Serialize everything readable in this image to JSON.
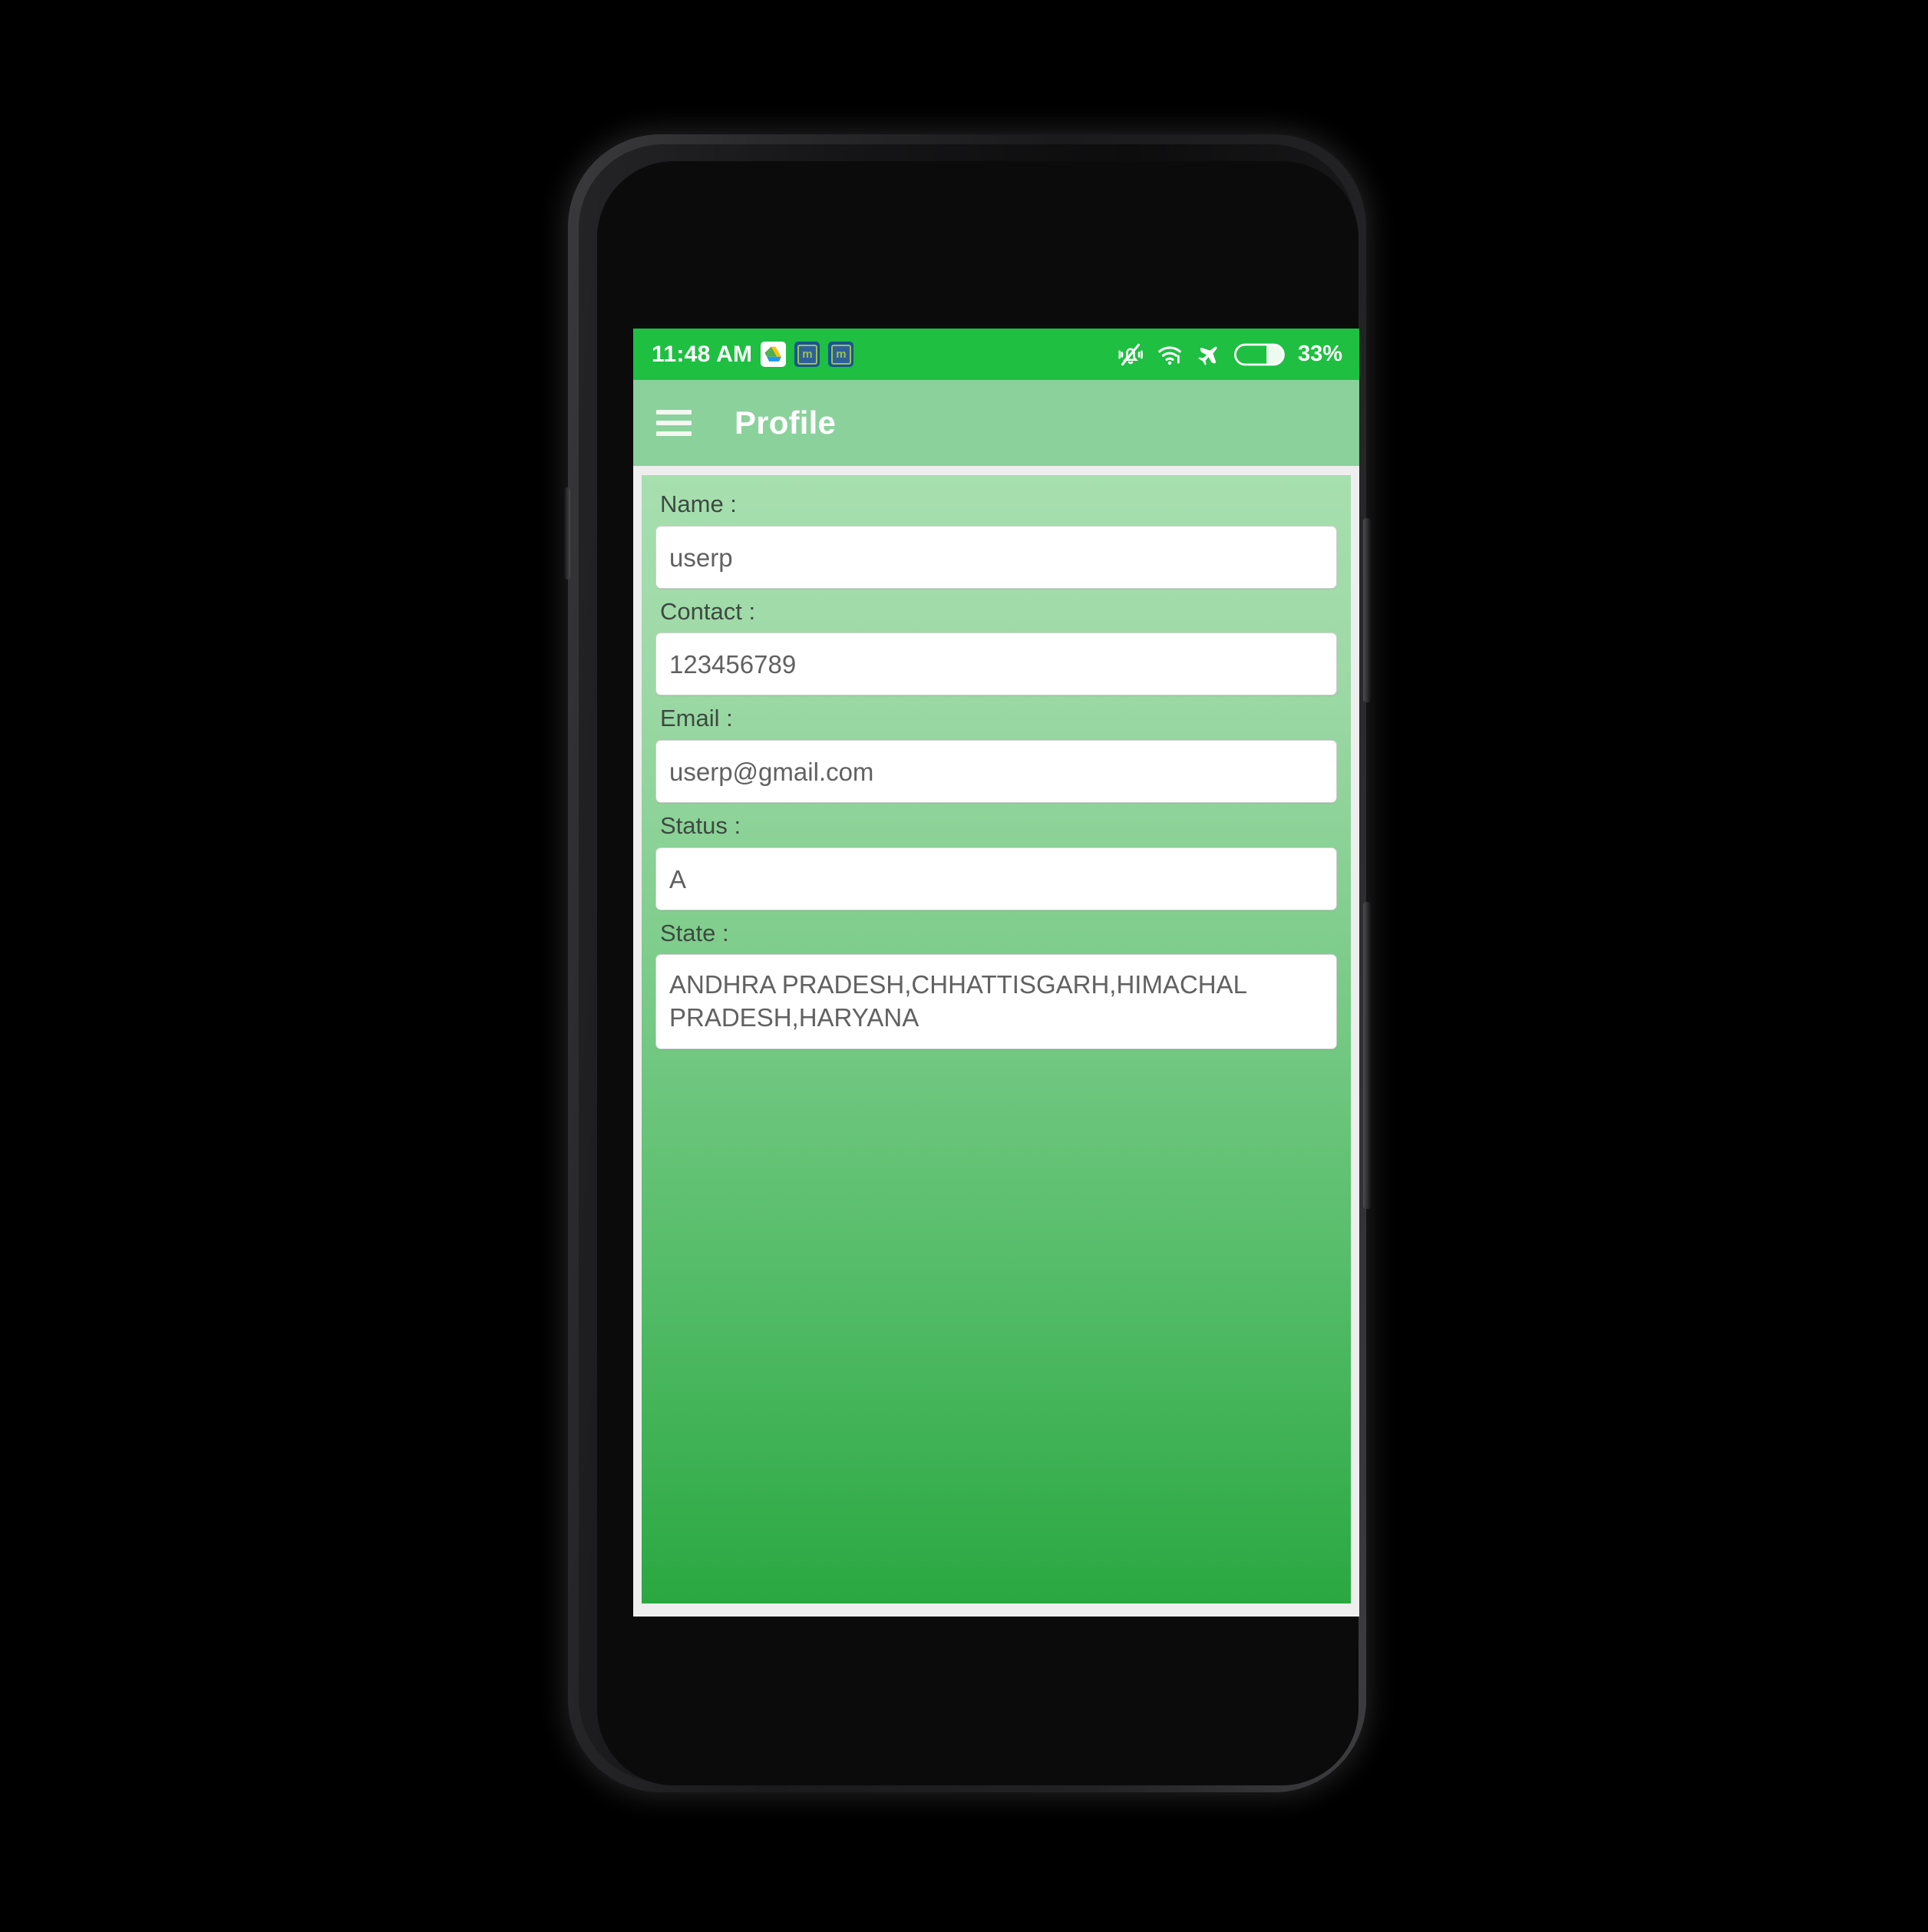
{
  "status_bar": {
    "clock": "11:48 AM",
    "notification_icons": [
      {
        "name": "google-drive-icon",
        "label": ""
      },
      {
        "name": "app-icon-m-1",
        "label": "m"
      },
      {
        "name": "app-icon-m-2",
        "label": "m"
      }
    ],
    "system_icons": [
      {
        "name": "vibrate-off-icon"
      },
      {
        "name": "wifi-icon"
      },
      {
        "name": "airplane-mode-icon"
      },
      {
        "name": "battery-icon"
      }
    ],
    "battery_percent": "33%",
    "background_color": "#1fbf42"
  },
  "app_bar": {
    "menu_icon": "hamburger-menu-icon",
    "title": "Profile",
    "background_color": "#8bd19c",
    "title_color": "#ffffff"
  },
  "form": {
    "background_gradient_from": "#a7dfaf",
    "background_gradient_to": "#2aa841",
    "fields": [
      {
        "key": "name",
        "label": "Name :",
        "value": "userp",
        "multiline": false
      },
      {
        "key": "contact",
        "label": "Contact :",
        "value": "123456789",
        "multiline": false
      },
      {
        "key": "email",
        "label": "Email :",
        "value": "userp@gmail.com",
        "multiline": false
      },
      {
        "key": "status",
        "label": "Status :",
        "value": "A",
        "multiline": false
      },
      {
        "key": "state",
        "label": "State :",
        "value": "ANDHRA PRADESH,CHHATTISGARH,HIMACHAL PRADESH,HARYANA",
        "multiline": true
      }
    ]
  },
  "device": {
    "frame_color": "#1a1a1c",
    "hardware": [
      "front-camera",
      "earpiece-speaker",
      "proximity-sensor",
      "power-button",
      "volume-button"
    ]
  }
}
